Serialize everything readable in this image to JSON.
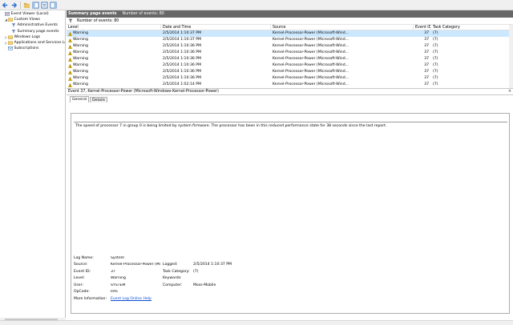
{
  "toolbar": {
    "icons": [
      "back-icon",
      "forward-icon",
      "folder-up-icon",
      "console-tree-icon",
      "properties-icon",
      "help-icon",
      "pane-icon"
    ]
  },
  "tree": {
    "items": [
      {
        "label": "Event Viewer (Local)",
        "level": 0,
        "expander": "",
        "icon": "event-viewer-icon"
      },
      {
        "label": "Custom Views",
        "level": 1,
        "expander": "◢",
        "icon": "folder-icon"
      },
      {
        "label": "Administrative Events",
        "level": 2,
        "expander": "",
        "icon": "filter-icon"
      },
      {
        "label": "Summary page events",
        "level": 2,
        "expander": "",
        "icon": "filter-icon"
      },
      {
        "label": "Windows Logs",
        "level": 1,
        "expander": "▷",
        "icon": "folder-icon"
      },
      {
        "label": "Applications and Services Lo",
        "level": 1,
        "expander": "▷",
        "icon": "folder-icon"
      },
      {
        "label": "Subscriptions",
        "level": 1,
        "expander": "",
        "icon": "subscriptions-icon"
      }
    ]
  },
  "header": {
    "title": "Summary page events",
    "count": "Number of events: 80"
  },
  "filter": {
    "text": "Number of events: 80"
  },
  "columns": [
    "Level",
    "Date and Time",
    "Source",
    "Event ID",
    "Task Category"
  ],
  "events": [
    {
      "level": "Warning",
      "datetime": "2/5/2014 1:10:37 PM",
      "source": "Kernel-Processor-Power (Microsoft-Wind...",
      "id": "37",
      "task": "(7)",
      "selected": true
    },
    {
      "level": "Warning",
      "datetime": "2/5/2014 1:10:37 PM",
      "source": "Kernel-Processor-Power (Microsoft-Wind...",
      "id": "37",
      "task": "(7)"
    },
    {
      "level": "Warning",
      "datetime": "2/5/2014 1:10:36 PM",
      "source": "Kernel-Processor-Power (Microsoft-Wind...",
      "id": "37",
      "task": "(7)"
    },
    {
      "level": "Warning",
      "datetime": "2/5/2014 1:10:36 PM",
      "source": "Kernel-Processor-Power (Microsoft-Wind...",
      "id": "37",
      "task": "(7)"
    },
    {
      "level": "Warning",
      "datetime": "2/5/2014 1:10:36 PM",
      "source": "Kernel-Processor-Power (Microsoft-Wind...",
      "id": "37",
      "task": "(7)"
    },
    {
      "level": "Warning",
      "datetime": "2/5/2014 1:10:36 PM",
      "source": "Kernel-Processor-Power (Microsoft-Wind...",
      "id": "37",
      "task": "(7)"
    },
    {
      "level": "Warning",
      "datetime": "2/5/2014 1:10:36 PM",
      "source": "Kernel-Processor-Power (Microsoft-Wind...",
      "id": "37",
      "task": "(7)"
    },
    {
      "level": "Warning",
      "datetime": "2/5/2014 1:10:36 PM",
      "source": "Kernel-Processor-Power (Microsoft-Wind...",
      "id": "37",
      "task": "(7)"
    },
    {
      "level": "Warning",
      "datetime": "2/5/2014 1:02:14 PM",
      "source": "Kernel-Processor-Power (Microsoft-Wind...",
      "id": "37",
      "task": "(7)"
    },
    {
      "level": "Warning",
      "datetime": "2/5/2014 1:10:36 PM",
      "source": "Kernel-Processor-Power (Microsoft-Wind...",
      "id": "37",
      "task": "(7)"
    }
  ],
  "detail": {
    "title": "Event 37, Kernel-Processor-Power (Microsoft-Windows-Kernel-Processor-Power)",
    "close": "×",
    "tabs": [
      "General",
      "Details"
    ],
    "message": "The speed of processor 7 in group 0 is being limited by system firmware. The processor has been in this reduced performance state for 38 seconds since the last report.",
    "props": {
      "log_name_label": "Log Name:",
      "log_name": "System",
      "source_label": "Source:",
      "source": "Kernel-Processor-Power (Mi",
      "logged_label": "Logged:",
      "logged": "2/5/2014 1:10:37 PM",
      "event_id_label": "Event ID:",
      "event_id": "37",
      "task_label": "Task Category:",
      "task": "(7)",
      "level_label": "Level:",
      "level": "Warning",
      "keywords_label": "Keywords:",
      "keywords": "",
      "user_label": "User:",
      "user": "SYSTEM",
      "computer_label": "Computer:",
      "computer": "Moss-Mobile",
      "opcode_label": "OpCode:",
      "opcode": "Info",
      "more_label": "More Information:",
      "more_link": "Event Log Online Help"
    }
  },
  "colors": {
    "header_bg": "#676767",
    "selected_row": "#cce8ff",
    "link": "#0b4fd6",
    "warning": "#f5c400"
  }
}
